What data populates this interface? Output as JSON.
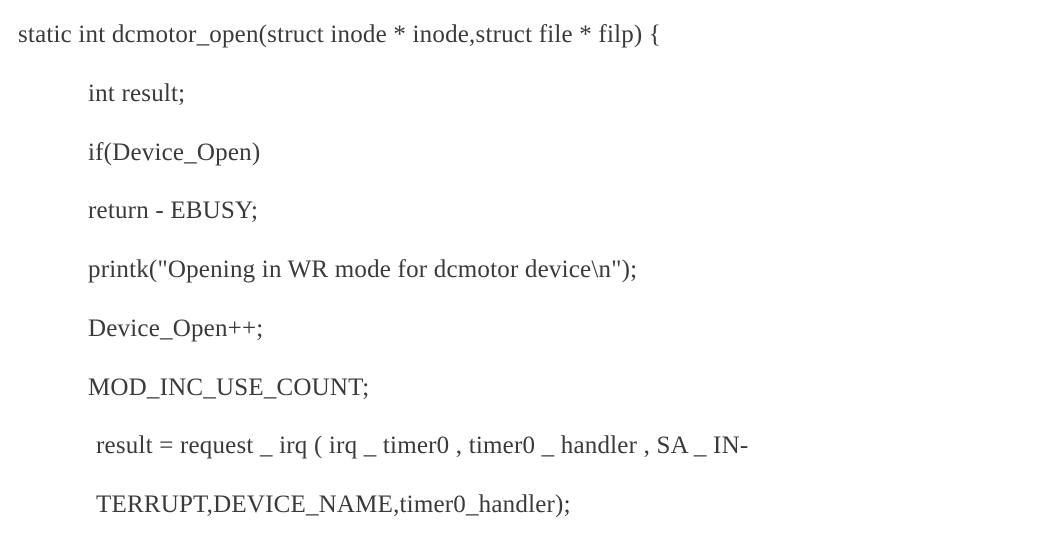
{
  "code": {
    "line1": "static int dcmotor_open(struct inode * inode,struct file * filp) {",
    "line2": "int result;",
    "line3": "if(Device_Open)",
    "line4": "return - EBUSY;",
    "line5": "printk(\"Opening in WR mode for dcmotor device\\n\");",
    "line6": "Device_Open++;",
    "line7": "MOD_INC_USE_COUNT;",
    "line8": "result = request _ irq ( irq _ timer0 , timer0 _ handler , SA _ IN-",
    "line9": "TERRUPT,DEVICE_NAME,timer0_handler);"
  }
}
